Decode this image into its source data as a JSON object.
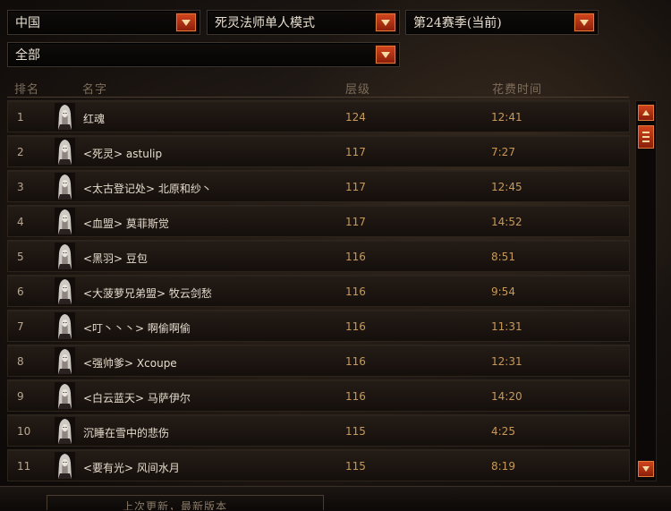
{
  "filters": {
    "region": "中国",
    "mode": "死灵法师单人模式",
    "season": "第24赛季(当前)",
    "clan": "全部"
  },
  "columns": {
    "rank": "排名",
    "name": "名字",
    "level": "层级",
    "time": "花费时间"
  },
  "rows": [
    {
      "rank": "1",
      "name": "红魂",
      "level": "124",
      "time": "12:41"
    },
    {
      "rank": "2",
      "name": "<死灵> astulip",
      "level": "117",
      "time": "7:27"
    },
    {
      "rank": "3",
      "name": "<太古登记处> 北原和纱丶",
      "level": "117",
      "time": "12:45"
    },
    {
      "rank": "4",
      "name": "<血盟> 莫菲斯觉",
      "level": "117",
      "time": "14:52"
    },
    {
      "rank": "5",
      "name": "<黑羽> 豆包",
      "level": "116",
      "time": "8:51"
    },
    {
      "rank": "6",
      "name": "<大菠萝兄弟盟> 牧云剑愁",
      "level": "116",
      "time": "9:54"
    },
    {
      "rank": "7",
      "name": "<叮丶丶丶> 啊偷啊偷",
      "level": "116",
      "time": "11:31"
    },
    {
      "rank": "8",
      "name": "<强帅爹> Xcoupe",
      "level": "116",
      "time": "12:31"
    },
    {
      "rank": "9",
      "name": "<白云蓝天> 马萨伊尔",
      "level": "116",
      "time": "14:20"
    },
    {
      "rank": "10",
      "name": "沉睡在雪中的悲伤",
      "level": "115",
      "time": "4:25"
    },
    {
      "rank": "11",
      "name": "<要有光> 风间水月",
      "level": "115",
      "time": "8:19"
    }
  ],
  "footer": {
    "text": "上次更新，最新版本"
  },
  "icons": {
    "dropdown": "chevron-down-icon",
    "portrait": "necromancer-portrait-icon",
    "scroll_up": "scroll-up-icon",
    "scroll_down": "scroll-down-icon"
  },
  "colors": {
    "accent": "#b8360f",
    "level_text": "#c79a5a",
    "name_text": "#e6dccd"
  }
}
